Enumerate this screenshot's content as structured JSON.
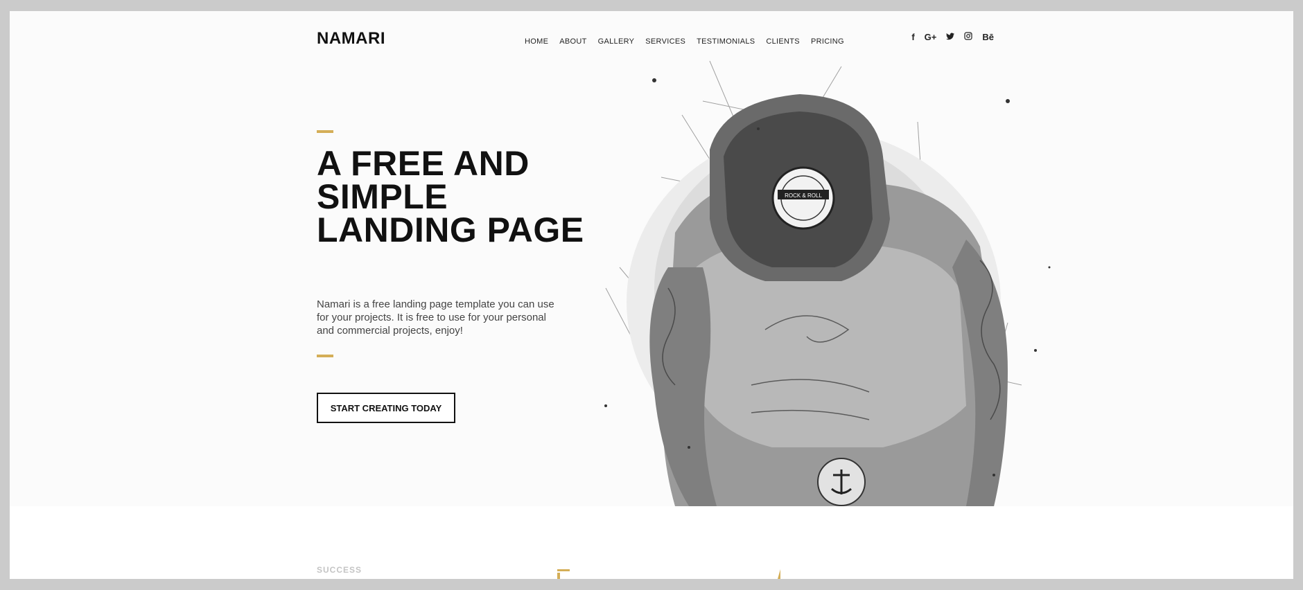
{
  "brand": {
    "logo": "NAMARI"
  },
  "nav": {
    "items": [
      "HOME",
      "ABOUT",
      "GALLERY",
      "SERVICES",
      "TESTIMONIALS",
      "CLIENTS",
      "PRICING"
    ]
  },
  "social": {
    "icons": [
      {
        "name": "facebook-icon",
        "glyph": "f"
      },
      {
        "name": "google-plus-icon",
        "glyph": "G+"
      },
      {
        "name": "twitter-icon",
        "glyph": "🐦"
      },
      {
        "name": "instagram-icon",
        "glyph": "◎"
      },
      {
        "name": "behance-icon",
        "glyph": "Bē"
      }
    ]
  },
  "hero": {
    "headline": "A FREE AND SIMPLE LANDING PAGE",
    "description": "Namari is a free landing page template you can use for your projects. It is free to use for your personal and commercial projects, enjoy!",
    "cta_label": "START CREATING TODAY",
    "image_alt": "tattooed-man-sketch-illustration"
  },
  "next_section": {
    "label": "SUCCESS"
  },
  "colors": {
    "accent": "#d4ae57",
    "text": "#111111",
    "background": "#fbfbfb"
  }
}
